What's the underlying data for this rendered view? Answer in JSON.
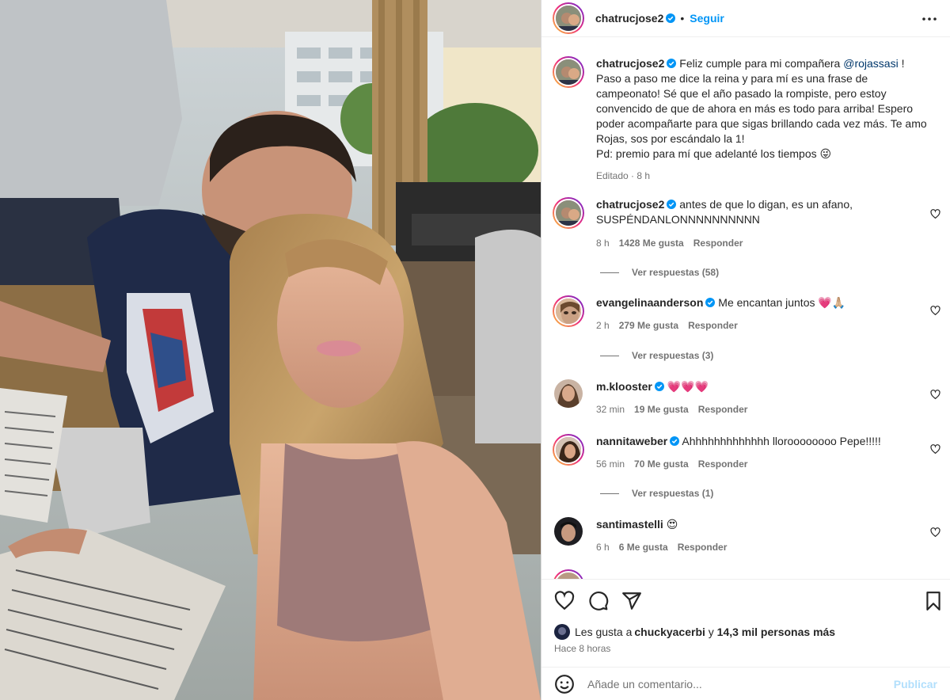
{
  "post": {
    "author": "chatrucjose2",
    "follow_label": "Seguir",
    "dot": "•",
    "caption_author": "chatrucjose2",
    "caption_pre": "Feliz cumple para mi compañera ",
    "caption_mention": "@rojassasi",
    "caption_post": " ! Paso a paso me dice la reina y para mí es una frase de campeonato! Sé que el año pasado la rompiste, pero estoy convencido de que de ahora en más es todo para arriba! Espero poder acompañarte para que sigas brillando cada vez más. Te amo Rojas, sos por escándalo la 1!",
    "caption_pd": "Pd: premio para mí que adelanté los tiempos 😜",
    "caption_meta": "Editado · 8 h"
  },
  "comments": [
    {
      "user": "chatrucjose2",
      "text": "antes de que lo digan, es un afano, SUSPÉNDANLONNNNNNNNNN",
      "time": "8 h",
      "likes": "1428 Me gusta",
      "reply": "Responder",
      "replies": "Ver respuestas (58)"
    },
    {
      "user": "evangelinaanderson",
      "text": "Me encantan juntos 💗🙏🏼",
      "time": "2 h",
      "likes": "279 Me gusta",
      "reply": "Responder",
      "replies": "Ver respuestas (3)"
    },
    {
      "user": "m.klooster",
      "text": "💗💗💗",
      "time": "32 min",
      "likes": "19 Me gusta",
      "reply": "Responder"
    },
    {
      "user": "nannitaweber",
      "text": "Ahhhhhhhhhhhhh lloroooooooo Pepe!!!!!",
      "time": "56 min",
      "likes": "70 Me gusta",
      "reply": "Responder",
      "replies": "Ver respuestas (1)"
    },
    {
      "user": "santimastelli",
      "text": "😍",
      "time": "6 h",
      "likes": "6 Me gusta",
      "reply": "Responder"
    }
  ],
  "footer": {
    "likes_prefix": "Les gusta a ",
    "likes_user": "chuckyacerbi",
    "likes_mid": " y ",
    "likes_count": "14,3 mil personas más",
    "time": "Hace 8 horas",
    "comment_placeholder": "Añade un comentario...",
    "publish_label": "Publicar"
  },
  "icons": {
    "more": "more-horizontal-icon",
    "like": "heart-icon",
    "comment": "comment-icon",
    "share": "share-icon",
    "save": "bookmark-icon",
    "emoji": "emoji-icon",
    "verified": "verified-badge-icon"
  },
  "colors": {
    "accent": "#0095f6",
    "verified": "#0095f6",
    "muted": "#737373",
    "publish_disabled": "#b2dffc"
  }
}
